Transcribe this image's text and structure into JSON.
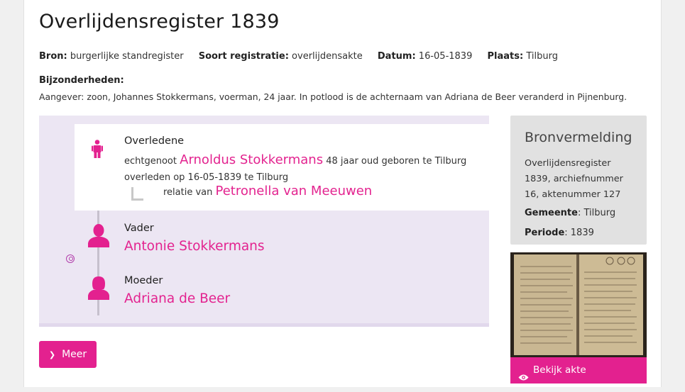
{
  "record": {
    "title": "Overlijdensregister 1839",
    "meta": [
      {
        "label": "Bron:",
        "value": "burgerlijke standregister"
      },
      {
        "label": "Soort registratie:",
        "value": "overlijdensakte"
      },
      {
        "label": "Datum:",
        "value": "16-05-1839"
      },
      {
        "label": "Plaats:",
        "value": "Tilburg"
      }
    ],
    "details_label": "Bijzonderheden:",
    "details_text": "Aangever: zoon, Johannes Stokkermans, voerman, 24 jaar. In potlood is de achternaam van Adriana de Beer veranderd in Pijnenburg."
  },
  "deceased": {
    "role": "Overledene",
    "prefix": "echtgenoot",
    "name": "Arnoldus Stokkermans",
    "age_text": "48 jaar oud geboren te Tilburg",
    "death_text": "overleden op 16-05-1839 te Tilburg",
    "relation_prefix": "relatie van",
    "relation_name": "Petronella van Meeuwen"
  },
  "father": {
    "role": "Vader",
    "name": "Antonie Stokkermans"
  },
  "mother": {
    "role": "Moeder",
    "name": "Adriana de Beer"
  },
  "more_button": {
    "label": "Meer"
  },
  "source": {
    "title": "Bronvermelding",
    "description": "Overlijdensregister 1839, archiefnummer 16, aktenummer 127",
    "gemeente_label": "Gemeente",
    "gemeente_value": ": Tilburg",
    "periode_label": "Periode",
    "periode_value": ": 1839",
    "view_label": "Bekijk akte"
  },
  "colors": {
    "accent": "#e3218f",
    "panel_bg": "#ece6f3",
    "source_bg": "#e1e1e1"
  },
  "icons": [
    "person-icon",
    "male-silhouette-icon",
    "female-silhouette-icon",
    "link-icon",
    "chevron-right-icon",
    "eye-icon"
  ]
}
